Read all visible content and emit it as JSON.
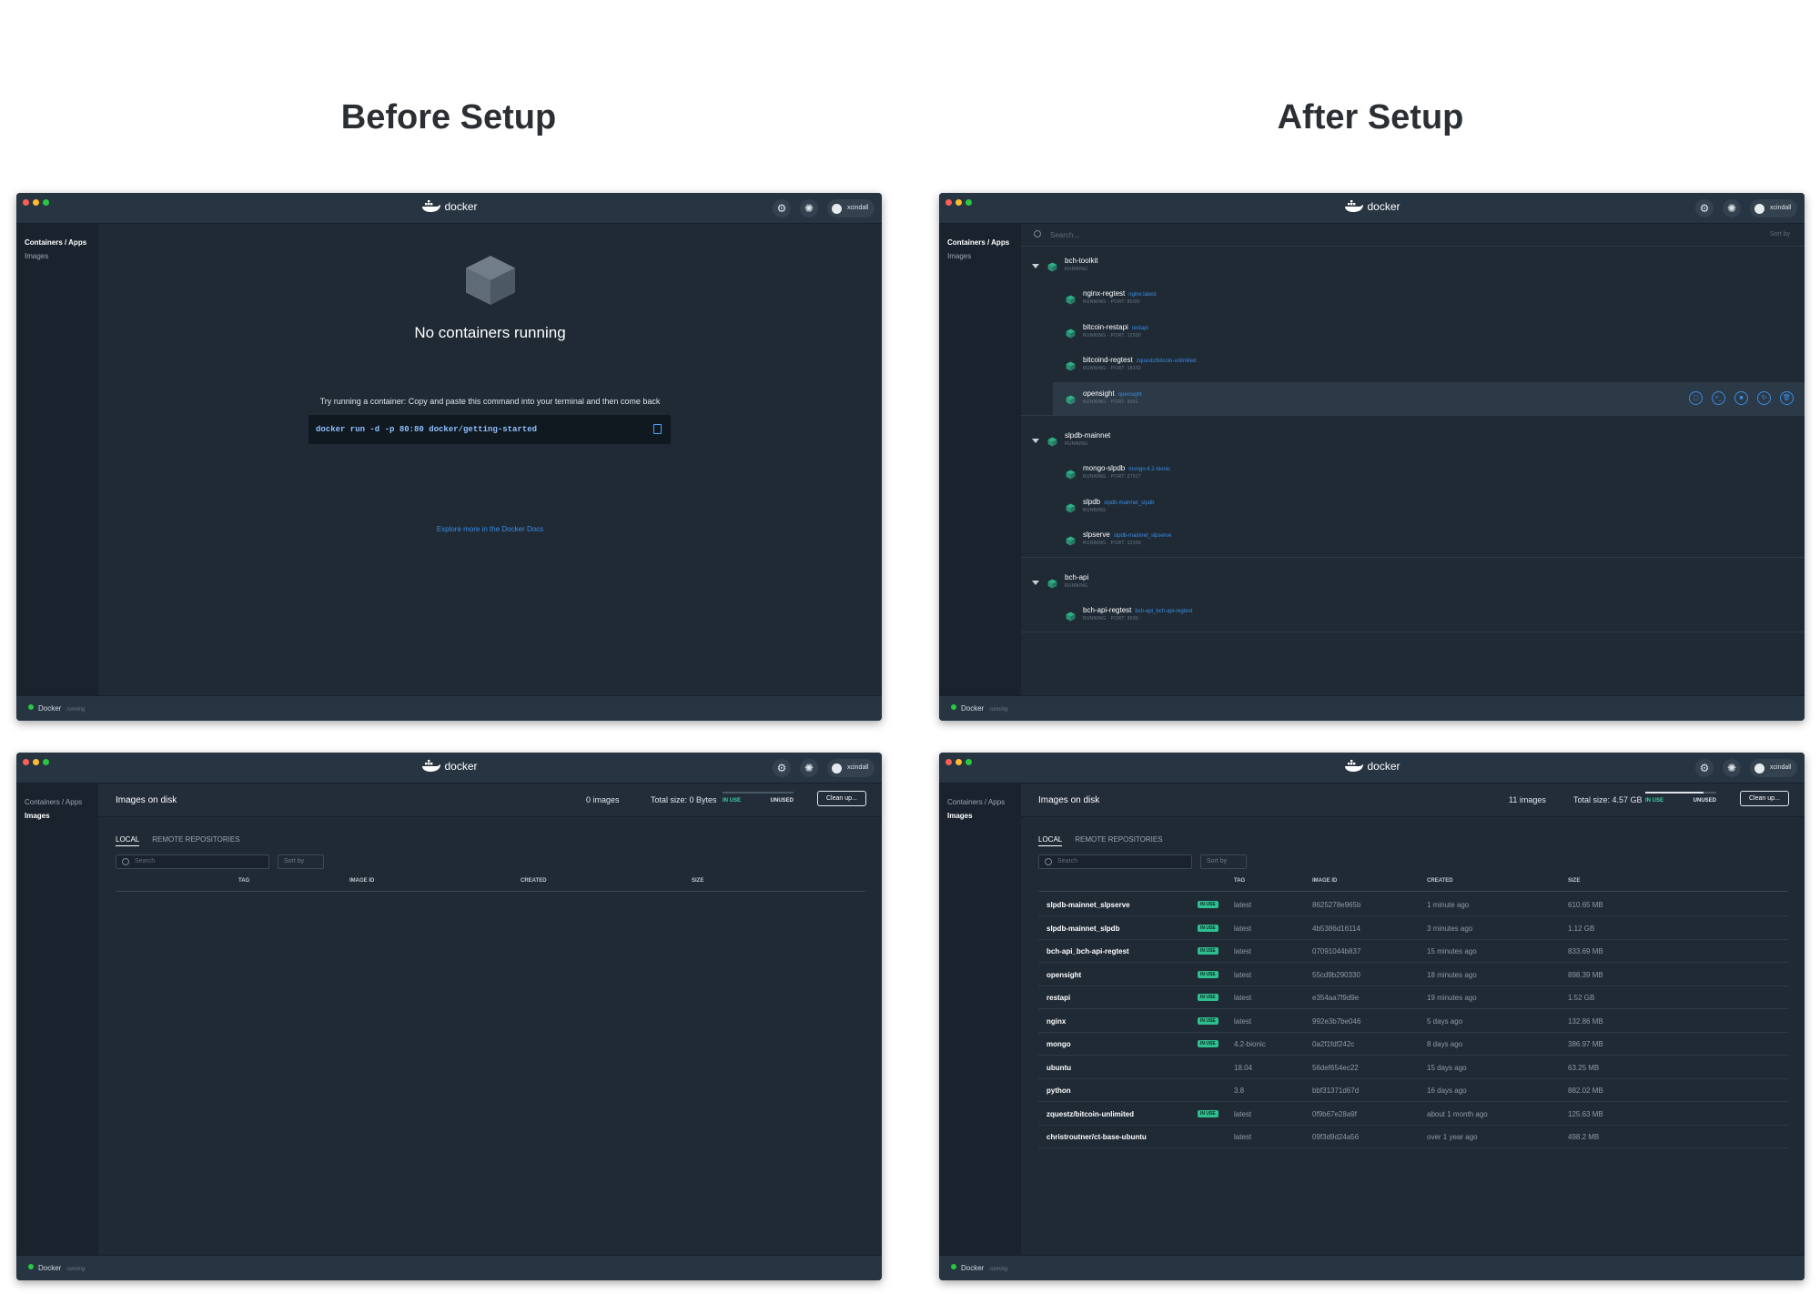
{
  "headings": {
    "before": "Before Setup",
    "after": "After Setup"
  },
  "app": {
    "logo": "docker",
    "user": "xcindall",
    "status_label": "Docker",
    "status_sub": "running"
  },
  "sidebar": {
    "containers": "Containers / Apps",
    "images": "Images"
  },
  "empty": {
    "title": "No containers running",
    "subtitle": "Try running a container: Copy and paste this command into your terminal and then come back",
    "command": "docker run -d -p 80:80 docker/getting-started",
    "link": "Explore more in the Docker Docs"
  },
  "images_panel": {
    "title": "Images on disk",
    "before": {
      "count": "0 images",
      "total": "Total size: 0 Bytes",
      "usage": 0
    },
    "after": {
      "count": "11 images",
      "total": "Total size: 4.57 GB",
      "usage": 0.82
    },
    "in_use": "IN USE",
    "unused": "UNUSED",
    "cleanup": "Clean up...",
    "tabs": [
      "LOCAL",
      "REMOTE REPOSITORIES"
    ],
    "search_placeholder": "Search",
    "sort": "Sort by",
    "columns": [
      "TAG",
      "IMAGE ID",
      "CREATED",
      "SIZE"
    ],
    "badge": "IN USE",
    "rows": [
      {
        "name": "slpdb-mainnet_slpserve",
        "in_use": true,
        "tag": "latest",
        "id": "8625278e965b",
        "created": "1 minute ago",
        "size": "610.65 MB"
      },
      {
        "name": "slpdb-mainnet_slpdb",
        "in_use": true,
        "tag": "latest",
        "id": "4b5386d16114",
        "created": "3 minutes ago",
        "size": "1.12 GB"
      },
      {
        "name": "bch-api_bch-api-regtest",
        "in_use": true,
        "tag": "latest",
        "id": "07091044b837",
        "created": "15 minutes ago",
        "size": "833.69 MB"
      },
      {
        "name": "opensight",
        "in_use": true,
        "tag": "latest",
        "id": "55cd9b290330",
        "created": "18 minutes ago",
        "size": "898.39 MB"
      },
      {
        "name": "restapi",
        "in_use": true,
        "tag": "latest",
        "id": "e354aa7f9d9e",
        "created": "19 minutes ago",
        "size": "1.52 GB"
      },
      {
        "name": "nginx",
        "in_use": true,
        "tag": "latest",
        "id": "992e3b7be046",
        "created": "5 days ago",
        "size": "132.86 MB"
      },
      {
        "name": "mongo",
        "in_use": true,
        "tag": "4.2-bionic",
        "id": "0a2f1fdf242c",
        "created": "8 days ago",
        "size": "386.97 MB"
      },
      {
        "name": "ubuntu",
        "in_use": false,
        "tag": "18.04",
        "id": "56def654ec22",
        "created": "15 days ago",
        "size": "63.25 MB"
      },
      {
        "name": "python",
        "in_use": false,
        "tag": "3.8",
        "id": "bbf31371d67d",
        "created": "16 days ago",
        "size": "882.02 MB"
      },
      {
        "name": "zquestz/bitcoin-unlimited",
        "in_use": true,
        "tag": "latest",
        "id": "0f9b67e28a9f",
        "created": "about 1 month ago",
        "size": "125.63 MB"
      },
      {
        "name": "christroutner/ct-base-ubuntu",
        "in_use": false,
        "tag": "latest",
        "id": "09f3d9d24a56",
        "created": "over 1 year ago",
        "size": "498.2 MB"
      }
    ]
  },
  "containers_panel": {
    "search_placeholder": "Search...",
    "sort": "Sort by",
    "groups": [
      {
        "name": "bch-toolkit",
        "status": "RUNNING",
        "children": [
          {
            "name": "nginx-regtest",
            "image": "nginx:latest",
            "status": "RUNNING · PORT: 80/00"
          },
          {
            "name": "bitcoin-restapi",
            "image": "restapi",
            "status": "RUNNING · PORT: 12500"
          },
          {
            "name": "bitcoind-regtest",
            "image": "zquestz/bitcoin-unlimited",
            "status": "RUNNING · PORT: 18332"
          },
          {
            "name": "opensight",
            "image": "opensight",
            "status": "RUNNING · PORT: 3001",
            "highlight": true
          }
        ]
      },
      {
        "name": "slpdb-mainnet",
        "status": "RUNNING",
        "children": [
          {
            "name": "mongo-slpdb",
            "image": "mongo:4.2-bionic",
            "status": "RUNNING · PORT: 27017"
          },
          {
            "name": "slpdb",
            "image": "slpdb-mainnet_slpdb",
            "status": "RUNNING"
          },
          {
            "name": "slpserve",
            "image": "slpdb-mainnet_slpserve",
            "status": "RUNNING · PORT: 12300"
          }
        ]
      },
      {
        "name": "bch-api",
        "status": "RUNNING",
        "children": [
          {
            "name": "bch-api-regtest",
            "image": "bch-api_bch-api-regtest",
            "status": "RUNNING · PORT: 3000"
          }
        ]
      }
    ]
  }
}
